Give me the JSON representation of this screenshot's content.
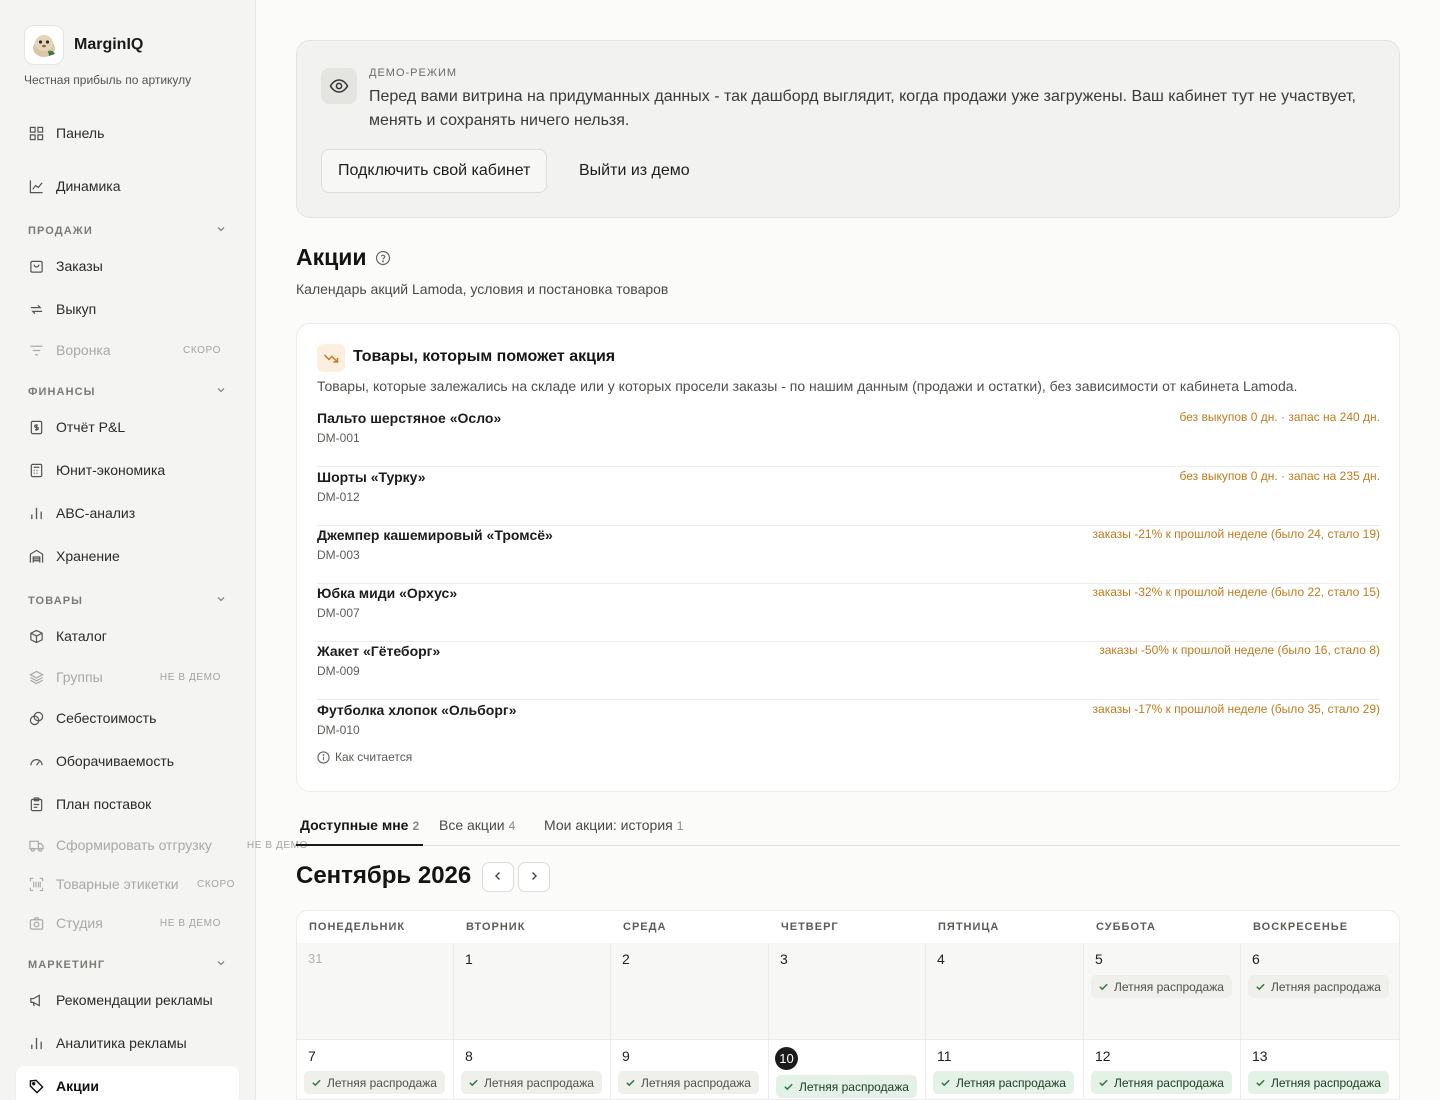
{
  "brand": {
    "name": "MarginIQ",
    "tagline": "Честная прибыль по артикулу"
  },
  "nav": {
    "panel": "Панель",
    "dynamics": "Динамика",
    "sections": {
      "sales": "ПРОДАЖИ",
      "finance": "ФИНАНСЫ",
      "goods": "ТОВАРЫ",
      "marketing": "МАРКЕТИНГ"
    },
    "orders": "Заказы",
    "buyout": "Выкуп",
    "funnel": "Воронка",
    "funnel_badge": "СКОРО",
    "pnl": "Отчёт P&L",
    "unit": "Юнит-экономика",
    "abc": "ABC-анализ",
    "storage": "Хранение",
    "catalog": "Каталог",
    "groups": "Группы",
    "groups_badge": "НЕ В ДЕМО",
    "cost": "Себестоимость",
    "turnover": "Оборачиваемость",
    "supply": "План поставок",
    "shipment": "Сформировать отгрузку",
    "shipment_badge": "НЕ В ДЕМО",
    "labels": "Товарные этикетки",
    "labels_badge": "СКОРО",
    "studio": "Студия",
    "studio_badge": "НЕ В ДЕМО",
    "ads_reco": "Рекомендации рекламы",
    "ads_analytics": "Аналитика рекламы",
    "promos": "Акции"
  },
  "demo": {
    "label": "ДЕМО-РЕЖИМ",
    "text": "Перед вами витрина на придуманных данных - так дашборд выглядит, когда продажи уже загружены. Ваш кабинет тут не участвует, менять и сохранять ничего нельзя.",
    "connect": "Подключить свой кабинет",
    "exit": "Выйти из демо"
  },
  "page": {
    "title": "Акции",
    "subtitle": "Календарь акций Lamoda, условия и постановка товаров"
  },
  "promo_help": {
    "title": "Товары, которым поможет акция",
    "desc": "Товары, которые залежались на складе или у которых просели заказы - по нашим данным (продажи и остатки), без зависимости от кабинета Lamoda.",
    "items": [
      {
        "name": "Пальто шерстяное «Осло»",
        "sku": "DM-001",
        "note": "без выкупов 0 дн. · запас на 240 дн."
      },
      {
        "name": "Шорты «Турку»",
        "sku": "DM-012",
        "note": "без выкупов 0 дн. · запас на 235 дн."
      },
      {
        "name": "Джемпер кашемировый «Тромсё»",
        "sku": "DM-003",
        "note": "заказы -21% к прошлой неделе (было 24, стало 19)"
      },
      {
        "name": "Юбка миди «Орхус»",
        "sku": "DM-007",
        "note": "заказы -32% к прошлой неделе (было 22, стало 15)"
      },
      {
        "name": "Жакет «Гётеборг»",
        "sku": "DM-009",
        "note": "заказы -50% к прошлой неделе (было 16, стало 8)"
      },
      {
        "name": "Футболка хлопок «Ольборг»",
        "sku": "DM-010",
        "note": "заказы -17% к прошлой неделе (было 35, стало 29)"
      }
    ],
    "how": "Как считается"
  },
  "tabs": [
    {
      "label": "Доступные мне",
      "count": "2"
    },
    {
      "label": "Все акции",
      "count": "4"
    },
    {
      "label": "Мои акции: история",
      "count": "1"
    }
  ],
  "calendar": {
    "month": "Сентябрь 2026",
    "weekdays": [
      "ПОНЕДЕЛЬНИК",
      "ВТОРНИК",
      "СРЕДА",
      "ЧЕТВЕРГ",
      "ПЯТНИЦА",
      "СУББОТА",
      "ВОСКРЕСЕНЬЕ"
    ],
    "event": "Летняя распродажа",
    "days": [
      "31",
      "1",
      "2",
      "3",
      "4",
      "5",
      "6",
      "7",
      "8",
      "9",
      "10",
      "11",
      "12",
      "13"
    ]
  }
}
